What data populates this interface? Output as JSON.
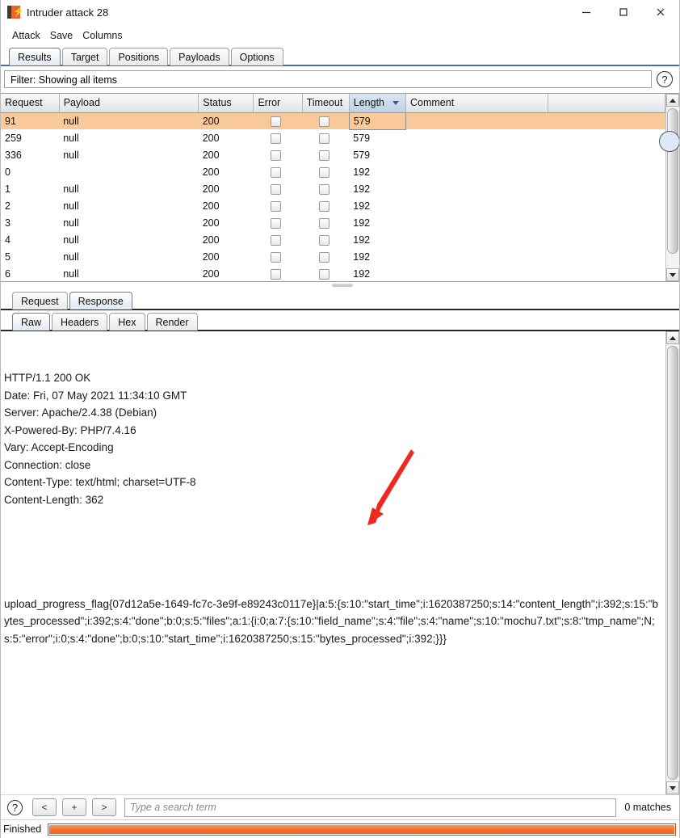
{
  "window": {
    "title": "Intruder attack 28",
    "icon": "burp-logo-icon",
    "minimize": "–",
    "maximize": "□",
    "close": "×"
  },
  "menubar": {
    "items": [
      "Attack",
      "Save",
      "Columns"
    ]
  },
  "tabs": {
    "items": [
      "Results",
      "Target",
      "Positions",
      "Payloads",
      "Options"
    ],
    "selected": "Results"
  },
  "filter": {
    "text": "Filter: Showing all items",
    "help": "?"
  },
  "results_table": {
    "columns": [
      "Request",
      "Payload",
      "Status",
      "Error",
      "Timeout",
      "Length",
      "Comment"
    ],
    "sorted_column": "Length",
    "sort_direction": "descending",
    "rows": [
      {
        "request": "91",
        "payload": "null",
        "status": "200",
        "error": false,
        "timeout": false,
        "length": "579",
        "comment": "",
        "selected": true
      },
      {
        "request": "259",
        "payload": "null",
        "status": "200",
        "error": false,
        "timeout": false,
        "length": "579",
        "comment": "",
        "selected": false
      },
      {
        "request": "336",
        "payload": "null",
        "status": "200",
        "error": false,
        "timeout": false,
        "length": "579",
        "comment": "",
        "selected": false
      },
      {
        "request": "0",
        "payload": "",
        "status": "200",
        "error": false,
        "timeout": false,
        "length": "192",
        "comment": "",
        "selected": false
      },
      {
        "request": "1",
        "payload": "null",
        "status": "200",
        "error": false,
        "timeout": false,
        "length": "192",
        "comment": "",
        "selected": false
      },
      {
        "request": "2",
        "payload": "null",
        "status": "200",
        "error": false,
        "timeout": false,
        "length": "192",
        "comment": "",
        "selected": false
      },
      {
        "request": "3",
        "payload": "null",
        "status": "200",
        "error": false,
        "timeout": false,
        "length": "192",
        "comment": "",
        "selected": false
      },
      {
        "request": "4",
        "payload": "null",
        "status": "200",
        "error": false,
        "timeout": false,
        "length": "192",
        "comment": "",
        "selected": false
      },
      {
        "request": "5",
        "payload": "null",
        "status": "200",
        "error": false,
        "timeout": false,
        "length": "192",
        "comment": "",
        "selected": false
      },
      {
        "request": "6",
        "payload": "null",
        "status": "200",
        "error": false,
        "timeout": false,
        "length": "192",
        "comment": "",
        "selected": false
      }
    ]
  },
  "message_tabs": {
    "items": [
      "Request",
      "Response"
    ],
    "selected": "Response"
  },
  "view_tabs": {
    "items": [
      "Raw",
      "Headers",
      "Hex",
      "Render"
    ],
    "selected": "Raw"
  },
  "response": {
    "headers": "HTTP/1.1 200 OK\nDate: Fri, 07 May 2021 11:34:10 GMT\nServer: Apache/2.4.38 (Debian)\nX-Powered-By: PHP/7.4.16\nVary: Accept-Encoding\nConnection: close\nContent-Type: text/html; charset=UTF-8\nContent-Length: 362",
    "body": "upload_progress_flag{07d12a5e-1649-fc7c-3e9f-e89243c0117e}|a:5:{s:10:\"start_time\";i:1620387250;s:14:\"content_length\";i:392;s:15:\"bytes_processed\";i:392;s:4:\"done\";b:0;s:5:\"files\";a:1:{i:0;a:7:{s:10:\"field_name\";s:4:\"file\";s:4:\"name\";s:10:\"mochu7.txt\";s:8:\"tmp_name\";N;s:5:\"error\";i:0;s:4:\"done\";b:0;s:10:\"start_time\";i:1620387250;s:15:\"bytes_processed\";i:392;}}}"
  },
  "search": {
    "help": "?",
    "prev_label": "<",
    "add_label": "+",
    "next_label": ">",
    "placeholder": "Type a search term",
    "value": "",
    "matches": "0 matches"
  },
  "status": {
    "label": "Finished",
    "progress_percent": 100
  },
  "colors": {
    "selection": "#fac99a",
    "progress": "#f5702f",
    "annotation_arrow": "#ee2a1e",
    "tab_underline": "#4a6e9c",
    "brand": "#e8622a"
  }
}
